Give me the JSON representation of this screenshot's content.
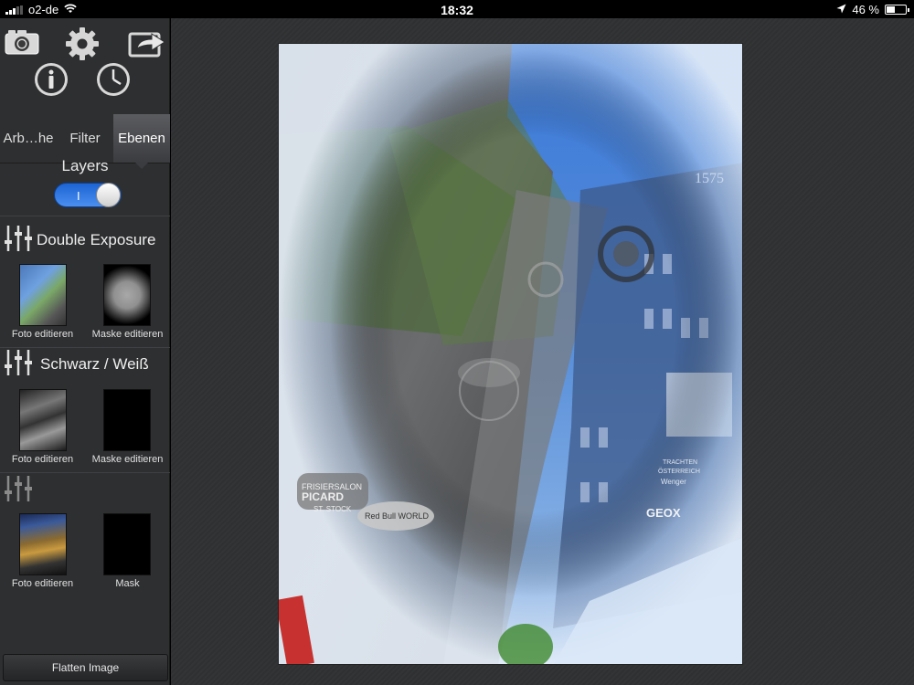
{
  "status_bar": {
    "carrier": "o2-de",
    "time": "18:32",
    "battery": "46 %",
    "battery_level": 0.46
  },
  "toolbar": {
    "icons": [
      "camera-icon",
      "gear-icon",
      "share-icon",
      "info-icon",
      "clock-icon"
    ]
  },
  "tabs": [
    {
      "label": "Arb…he",
      "active": false
    },
    {
      "label": "Filter",
      "active": false
    },
    {
      "label": "Ebenen",
      "active": true
    }
  ],
  "layers_panel": {
    "title": "Layers",
    "toggle_on": true,
    "toggle_mark": "I",
    "layers": [
      {
        "name": "Double Exposure",
        "photo_caption": "Foto editieren",
        "mask_caption": "Maske editieren"
      },
      {
        "name": "Schwarz / Weiß",
        "photo_caption": "Foto editieren",
        "mask_caption": "Maske editieren"
      },
      {
        "name": "",
        "photo_caption": "Foto editieren",
        "mask_caption": "Mask"
      }
    ],
    "flatten_label": "Flatten Image"
  },
  "canvas": {
    "signs": [
      "FRISIERSALON",
      "PICARD",
      "ST. STOCK",
      "Red Bull WORLD",
      "TRACHTEN",
      "ÖSTERREICH",
      "Wenger",
      "GEOX",
      "1575"
    ]
  }
}
